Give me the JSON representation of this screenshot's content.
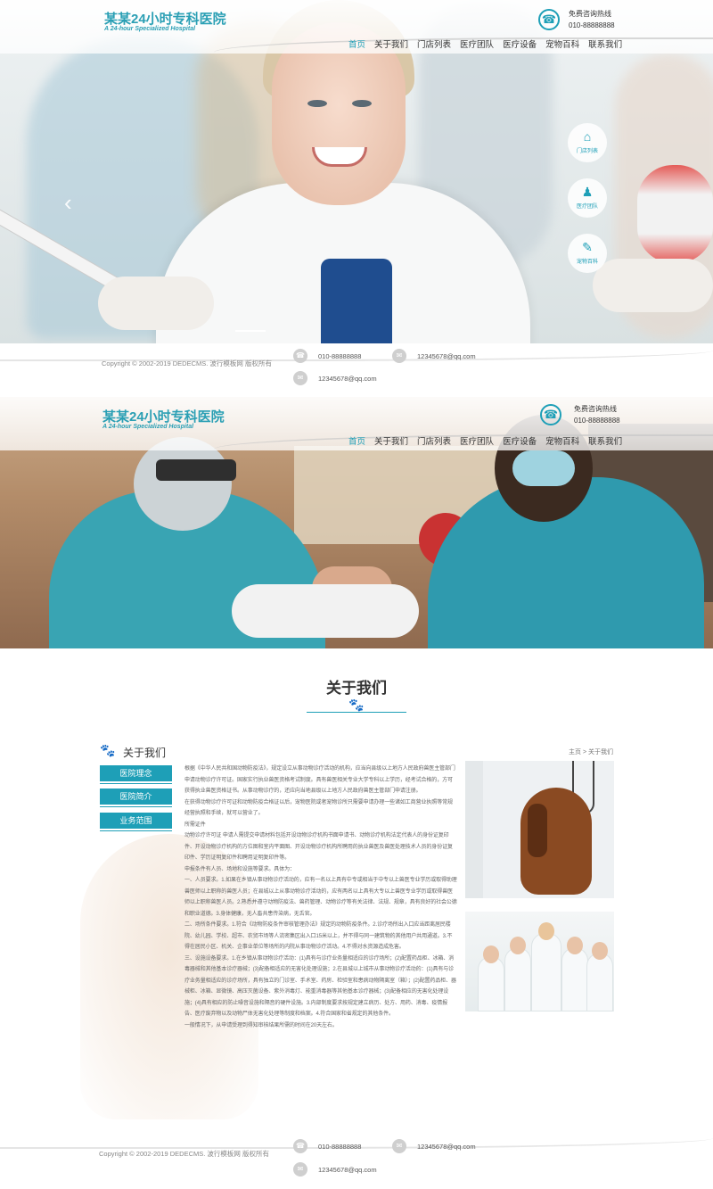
{
  "site": {
    "logo_cn": "某某24小时专科医院",
    "logo_en": "A 24-hour Specialized Hospital",
    "hotline_label": "免费咨询热线",
    "hotline_number": "010-88888888"
  },
  "nav": [
    "首页",
    "关于我们",
    "门店列表",
    "医疗团队",
    "医疗设备",
    "宠物百科",
    "联系我们"
  ],
  "side_buttons": [
    "门店列表",
    "医疗团队",
    "宠物百科"
  ],
  "footer": {
    "copyright": "Copyright © 2002-2019 DEDECMS. 波行模板网 版权所有",
    "phone": "010-88888888",
    "email1": "12345678@qq.com",
    "email2": "12345678@qq.com"
  },
  "about": {
    "section_title": "关于我们",
    "sidebar_title": "关于我们",
    "sidebar_links": [
      "医院理念",
      "医院简介",
      "业务范围"
    ],
    "breadcrumb": "主页 > 关于我们",
    "paragraphs": [
      "根据《中华人民共和国动物防疫法》，规定设立从事动物诊疗活动的机构，应当向县级以上地方人民政府兽医主管部门申请动物诊疗许可证。国家实行执业兽医资格考试制度。具有兽医相关专业大学专科以上学历，经考试合格的，方可获得执业兽医资格证书。从事动物诊疗的，还应向当地县级以上地方人民政府兽医主管部门申请注册。",
      "在获得动物诊疗许可证和动物防疫合格证以后，宠物医院或者宠物诊所只需要申请办理一些诸如工商营业执照等常规经营执照和手续，就可以营业了。",
      "所需证件",
      "动物诊疗许可证    申请人需提交申请材料包括开设动物诊疗机构书面申请书、动物诊疗机构法定代表人的身份证复印件、开设动物诊疗机构的方位图和室内平面图、开设动物诊疗机构所聘用的执业兽医及兽医处理技术人员的身份证复印件、学历证明复印件和聘用证明复印件等。",
      "申报条件有人员、场地和设施等要求。具体为：",
      "一、人员要求。1.如果在乡镇从事动物诊疗活动的，应有一名以上具有中专或相当于中专以上兽医专业学历或取得助理兽医师以上职称的兽医人员；在县城以上从事动物诊疗活动的，应有两名以上具有大专以上兽医专业学历或取得兽医师以上职称兽医人员。2.熟悉并遵守动物防疫法、兽药管理、动物诊疗等有关法律、法规、规章，具有良好的社会公德和职业道德。3.身体健康，无人畜共患传染病，无舌官。",
      "二、场所条件要求。1.符合《动物防疫条件审核管理办法》规定的动物防疫条件。2.诊疗场所出入口应当距离居民楼院、幼儿园、学校、超市、农贸市场等人流密集区出入口15米以上，并不得与同一建筑物的其他用户共用通道。3.不得在居民小区、机关、企事业单位等场所的内院从事动物诊疗活动。4.不得对水资源造成危害。",
      "三、设施设备要求。1.在乡镇从事动物诊疗活动：(1)具有与诊疗业务量相适应的诊疗场所；(2)配置药品柜、冰箱、消毒器械和其他基本诊疗器械；(3)配备相适应的无害化处理设施；2.在县城以上城市从事动物诊疗活动的：(1)具有与诊疗业务量相适应的诊疗场所，具有独立的门诊室、手术室、药房、检验室和患病动物隔离室（箱）；(2)配置药品柜、器械柜、冰箱、显微镜、高压灭菌设备、紫外消毒灯、能重消毒器等其他基本诊疗器械；(3)配备相应的无害化处理设施；(4)具有相应的防止噪音设施和隔音的硬件设施。3.内部制度要求按规定建立病历、处方、用药、消毒、疫情报告、医疗废弃物以及动物尸体无害化处理等制度和档案。4.符合国家和省规定的其他条件。",
      "一般情况下，从申请受理到得知审核结果所需的时间在20天左右。"
    ]
  },
  "colors": {
    "accent": "#1e9fb7"
  }
}
